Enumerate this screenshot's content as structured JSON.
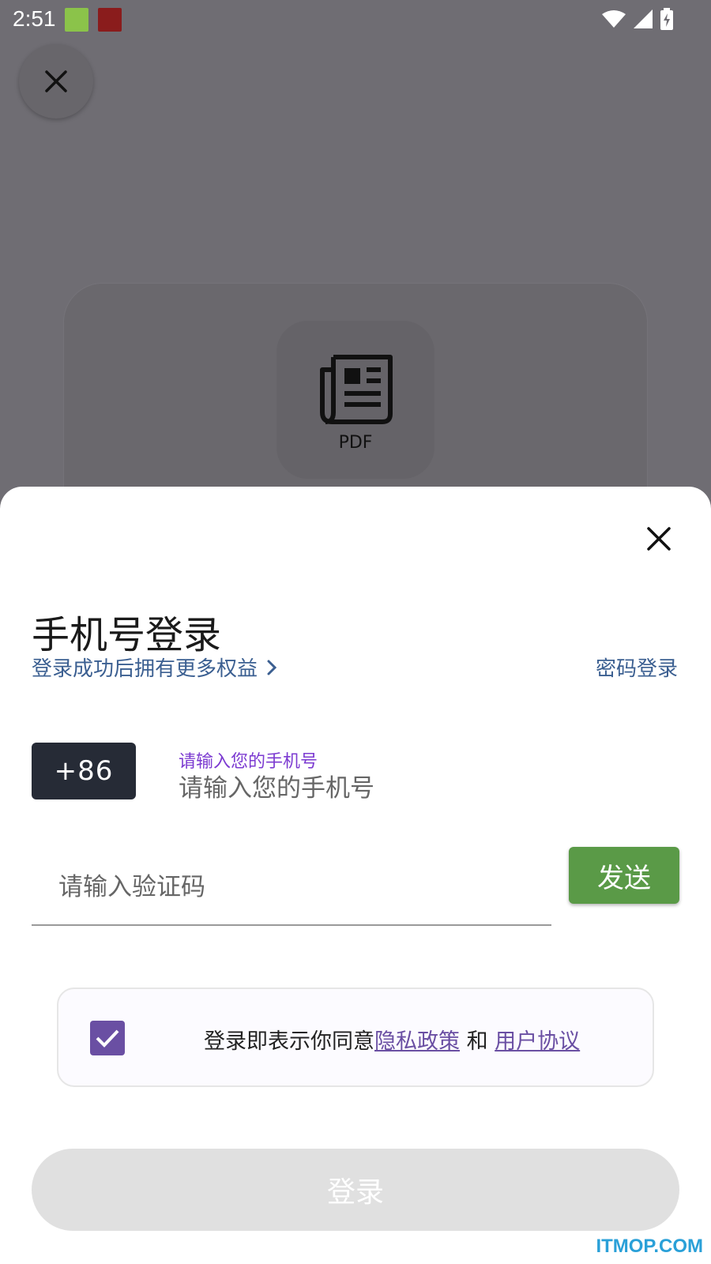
{
  "status_bar": {
    "time": "2:51"
  },
  "background": {
    "pdf_label": "PDF"
  },
  "login": {
    "title": "手机号登录",
    "subtitle": "登录成功后拥有更多权益",
    "password_login": "密码登录",
    "country_code": "+86",
    "phone_label": "请输入您的手机号",
    "phone_placeholder": "请输入您的手机号",
    "code_placeholder": "请输入验证码",
    "send_label": "发送",
    "agreement_prefix": "登录即表示你同意",
    "privacy_policy": "隐私政策",
    "and": " 和 ",
    "user_agreement": "用户协议",
    "login_button": "登录",
    "checkbox_checked": true
  },
  "watermark": "ITMOP.COM",
  "icons": {
    "close": "close-icon",
    "chevron": "chevron-right-icon",
    "pdf": "newspaper-icon",
    "check": "check-icon",
    "wifi": "wifi-icon",
    "signal": "signal-icon",
    "battery": "battery-icon"
  },
  "colors": {
    "send": "#5a9a47",
    "country_code_bg": "#262b36",
    "link": "#3b5f91",
    "accent_purple": "#6a4fa3",
    "label_purple": "#7c3bd1"
  }
}
